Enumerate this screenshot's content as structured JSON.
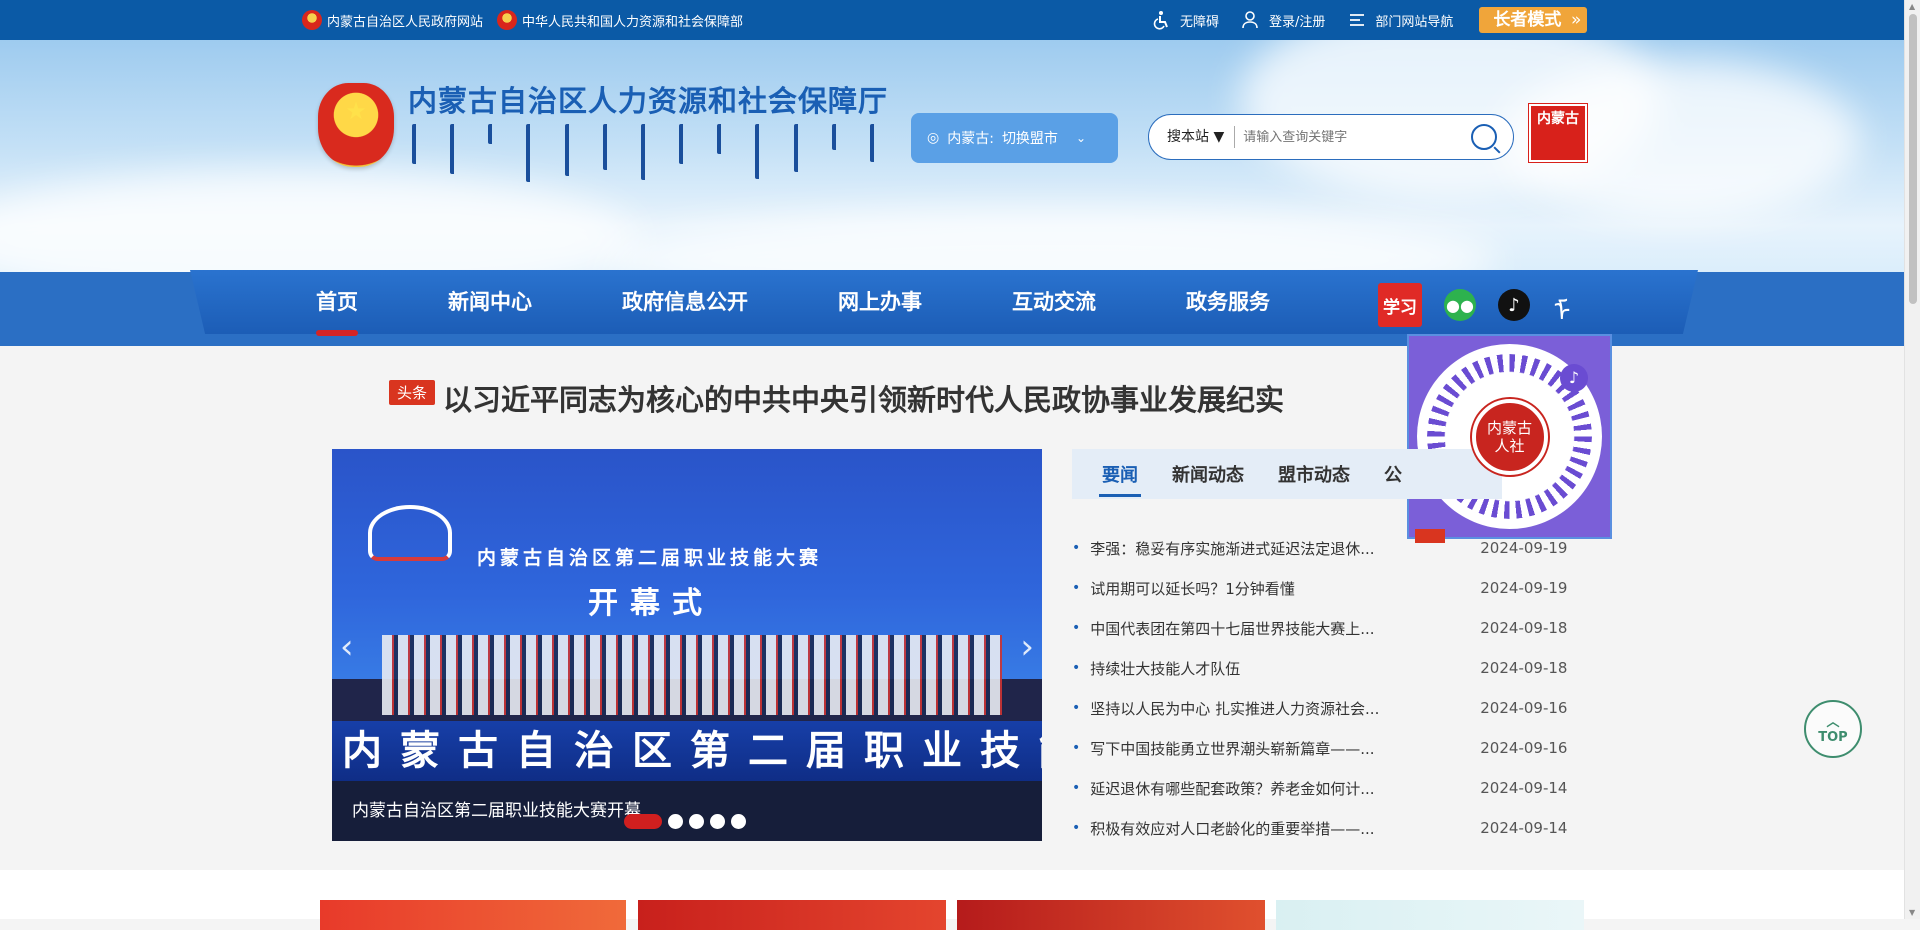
{
  "topbar": {
    "left_links": [
      {
        "label": "内蒙古自治区人民政府网站"
      },
      {
        "label": "中华人民共和国人力资源和社会保障部"
      }
    ],
    "accessibility": "无障碍",
    "login": "登录/注册",
    "dept_nav": "部门网站导航",
    "elder_mode": "长者模式"
  },
  "header": {
    "title": "内蒙古自治区人力资源和社会保障厅",
    "region_label": "内蒙古:",
    "region_switch": "切换盟市",
    "search_scope": "搜本站 ▼",
    "search_placeholder": "请输入查询关键字",
    "seal_text": "内蒙古"
  },
  "nav": {
    "items": [
      "首页",
      "新闻中心",
      "政府信息公开",
      "网上办事",
      "互动交流",
      "政务服务"
    ],
    "active": "首页",
    "icons": {
      "xuexi": "学习",
      "wechat": "wechat-icon",
      "tiktok": "tiktok-icon",
      "mongolian": "mongolian-script-icon"
    }
  },
  "qr_popup": {
    "center_text": "内蒙古人社"
  },
  "headline": {
    "tag": "头条",
    "text": "以习近平同志为核心的中共中央引领新时代人民政协事业发展纪实"
  },
  "carousel": {
    "screen_title": "内蒙古自治区第二届职业技能大赛",
    "screen_sub": "开幕式",
    "banner_text": "内蒙古自治区第二届职业技能",
    "caption": "内蒙古自治区第二届职业技能大赛开幕",
    "slide_count": 5,
    "active_index": 0
  },
  "news": {
    "tabs": [
      "要闻",
      "新闻动态",
      "盟市动态",
      "公"
    ],
    "active_tab": "要闻",
    "items": [
      {
        "title": "李强：稳妥有序实施渐进式延迟法定退休...",
        "date": "2024-09-19"
      },
      {
        "title": "试用期可以延长吗？1分钟看懂",
        "date": "2024-09-19"
      },
      {
        "title": "中国代表团在第四十七届世界技能大赛上...",
        "date": "2024-09-18"
      },
      {
        "title": "持续壮大技能人才队伍",
        "date": "2024-09-18"
      },
      {
        "title": "坚持以人民为中心 扎实推进人力资源社会...",
        "date": "2024-09-16"
      },
      {
        "title": "写下中国技能勇立世界潮头崭新篇章——...",
        "date": "2024-09-16"
      },
      {
        "title": "延迟退休有哪些配套政策？养老金如何计...",
        "date": "2024-09-14"
      },
      {
        "title": "积极有效应对人口老龄化的重要举措——...",
        "date": "2024-09-14"
      }
    ]
  },
  "top_button": "TOP",
  "colors": {
    "topbar": "#0b5aa6",
    "nav": "#2b6fc4",
    "accent_red": "#d42424",
    "elder": "#f0a53a"
  }
}
